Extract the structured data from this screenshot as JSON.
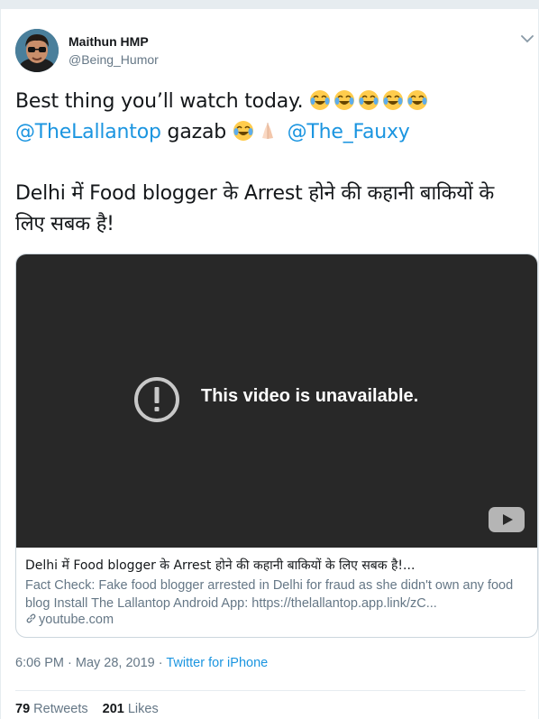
{
  "author": {
    "name": "Maithun HMP",
    "handle": "@Being_Humor"
  },
  "tweet": {
    "line1": "Best thing you’ll watch today.",
    "mention1": "@TheLallantop",
    "line2_mid": " gazab ",
    "mention2": "@The_Fauxy",
    "line3": "Delhi में Food blogger के Arrest होने की कहानी बाकियों के लिए सबक है!"
  },
  "emoji": {
    "laugh": "face-with-tears-of-joy-icon",
    "pray": "folded-hands-icon"
  },
  "media": {
    "unavailable_text": "This video is unavailable.",
    "title": "Delhi में Food blogger के Arrest होने की कहानी बाकियों के लिए सबक है!...",
    "description": "Fact Check: Fake food blogger arrested in Delhi for fraud as she didn't own any food blog Install The Lallantop Android App: https://thelallantop.app.link/zC...",
    "domain": "youtube.com"
  },
  "meta": {
    "time": "6:06 PM · May 28, 2019 · ",
    "source": "Twitter for iPhone"
  },
  "stats": {
    "retweets_count": "79",
    "retweets_label": " Retweets",
    "likes_count": "201",
    "likes_label": " Likes"
  },
  "colors": {
    "accent": "#1b95e0",
    "muted": "#657786",
    "text": "#14171a",
    "video_bg": "#282828"
  }
}
